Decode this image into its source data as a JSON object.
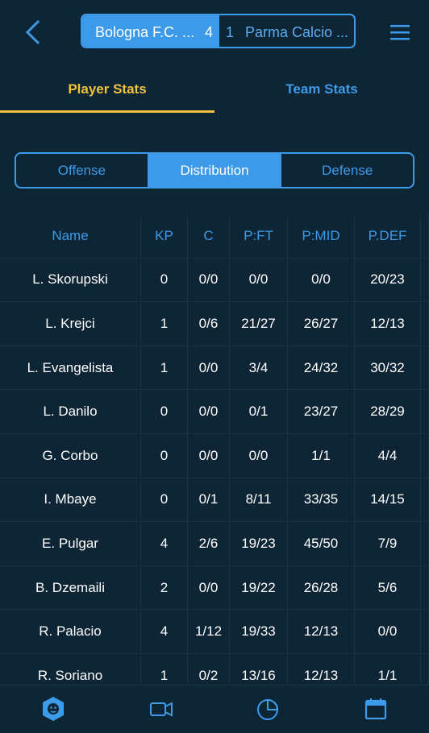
{
  "match": {
    "home_team": "Bologna F.C. ...",
    "home_score": "4",
    "away_score": "1",
    "away_team": "Parma Calcio ..."
  },
  "tabs": {
    "player_stats": "Player Stats",
    "team_stats": "Team Stats"
  },
  "segments": {
    "offense": "Offense",
    "distribution": "Distribution",
    "defense": "Defense"
  },
  "table": {
    "headers": [
      "Name",
      "KP",
      "C",
      "P:FT",
      "P:MID",
      "P.DEF"
    ],
    "rows": [
      [
        "L. Skorupski",
        "0",
        "0/0",
        "0/0",
        "0/0",
        "20/23"
      ],
      [
        "L. Krejci",
        "1",
        "0/6",
        "21/27",
        "26/27",
        "12/13"
      ],
      [
        "L. Evangelista",
        "1",
        "0/0",
        "3/4",
        "24/32",
        "30/32"
      ],
      [
        "L. Danilo",
        "0",
        "0/0",
        "0/1",
        "23/27",
        "28/29"
      ],
      [
        "G. Corbo",
        "0",
        "0/0",
        "0/0",
        "1/1",
        "4/4"
      ],
      [
        "I. Mbaye",
        "0",
        "0/1",
        "8/11",
        "33/35",
        "14/15"
      ],
      [
        "E. Pulgar",
        "4",
        "2/6",
        "19/23",
        "45/50",
        "7/9"
      ],
      [
        "B. Dzemaili",
        "2",
        "0/0",
        "19/22",
        "26/28",
        "5/6"
      ],
      [
        "R. Palacio",
        "4",
        "1/12",
        "19/33",
        "12/13",
        "0/0"
      ],
      [
        "R. Soriano",
        "1",
        "0/2",
        "13/16",
        "12/13",
        "1/1"
      ]
    ]
  },
  "bottom_nav": [
    "lion-badge-icon",
    "video-camera-icon",
    "pie-chart-icon",
    "calendar-icon"
  ],
  "colors": {
    "background": "#0d2535",
    "accent_blue": "#3d9ae8",
    "accent_yellow": "#f0c33c"
  }
}
